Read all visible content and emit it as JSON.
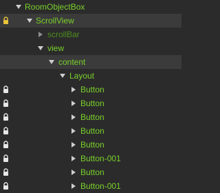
{
  "hierarchy": {
    "nodes": [
      {
        "label": "RoomObjectBox",
        "expanded": true,
        "locked": false,
        "selected": false,
        "muted": false
      },
      {
        "label": "ScrollView",
        "expanded": true,
        "locked": true,
        "selected": true,
        "muted": false
      },
      {
        "label": "scrollBar",
        "expanded": false,
        "locked": false,
        "selected": false,
        "muted": true
      },
      {
        "label": "view",
        "expanded": true,
        "locked": false,
        "selected": false,
        "muted": false
      },
      {
        "label": "content",
        "expanded": true,
        "locked": false,
        "selected": true,
        "muted": false
      },
      {
        "label": "Layout",
        "expanded": true,
        "locked": false,
        "selected": false,
        "muted": false
      },
      {
        "label": "Button",
        "expanded": false,
        "locked": true,
        "selected": false,
        "muted": false
      },
      {
        "label": "Button",
        "expanded": false,
        "locked": true,
        "selected": false,
        "muted": false
      },
      {
        "label": "Button",
        "expanded": false,
        "locked": true,
        "selected": false,
        "muted": false
      },
      {
        "label": "Button",
        "expanded": false,
        "locked": true,
        "selected": false,
        "muted": false
      },
      {
        "label": "Button",
        "expanded": false,
        "locked": true,
        "selected": false,
        "muted": false
      },
      {
        "label": "Button-001",
        "expanded": false,
        "locked": true,
        "selected": false,
        "muted": false
      },
      {
        "label": "Button",
        "expanded": false,
        "locked": true,
        "selected": false,
        "muted": false
      },
      {
        "label": "Button-001",
        "expanded": false,
        "locked": true,
        "selected": false,
        "muted": false
      }
    ]
  },
  "colors": {
    "background": "#2b2b2b",
    "selected_row": "#3b3b3b",
    "label_green": "#7ad12a",
    "label_muted": "#4f8f1f",
    "lock_locked": "#e8c23a",
    "lock_default": "#e6e6e6"
  }
}
